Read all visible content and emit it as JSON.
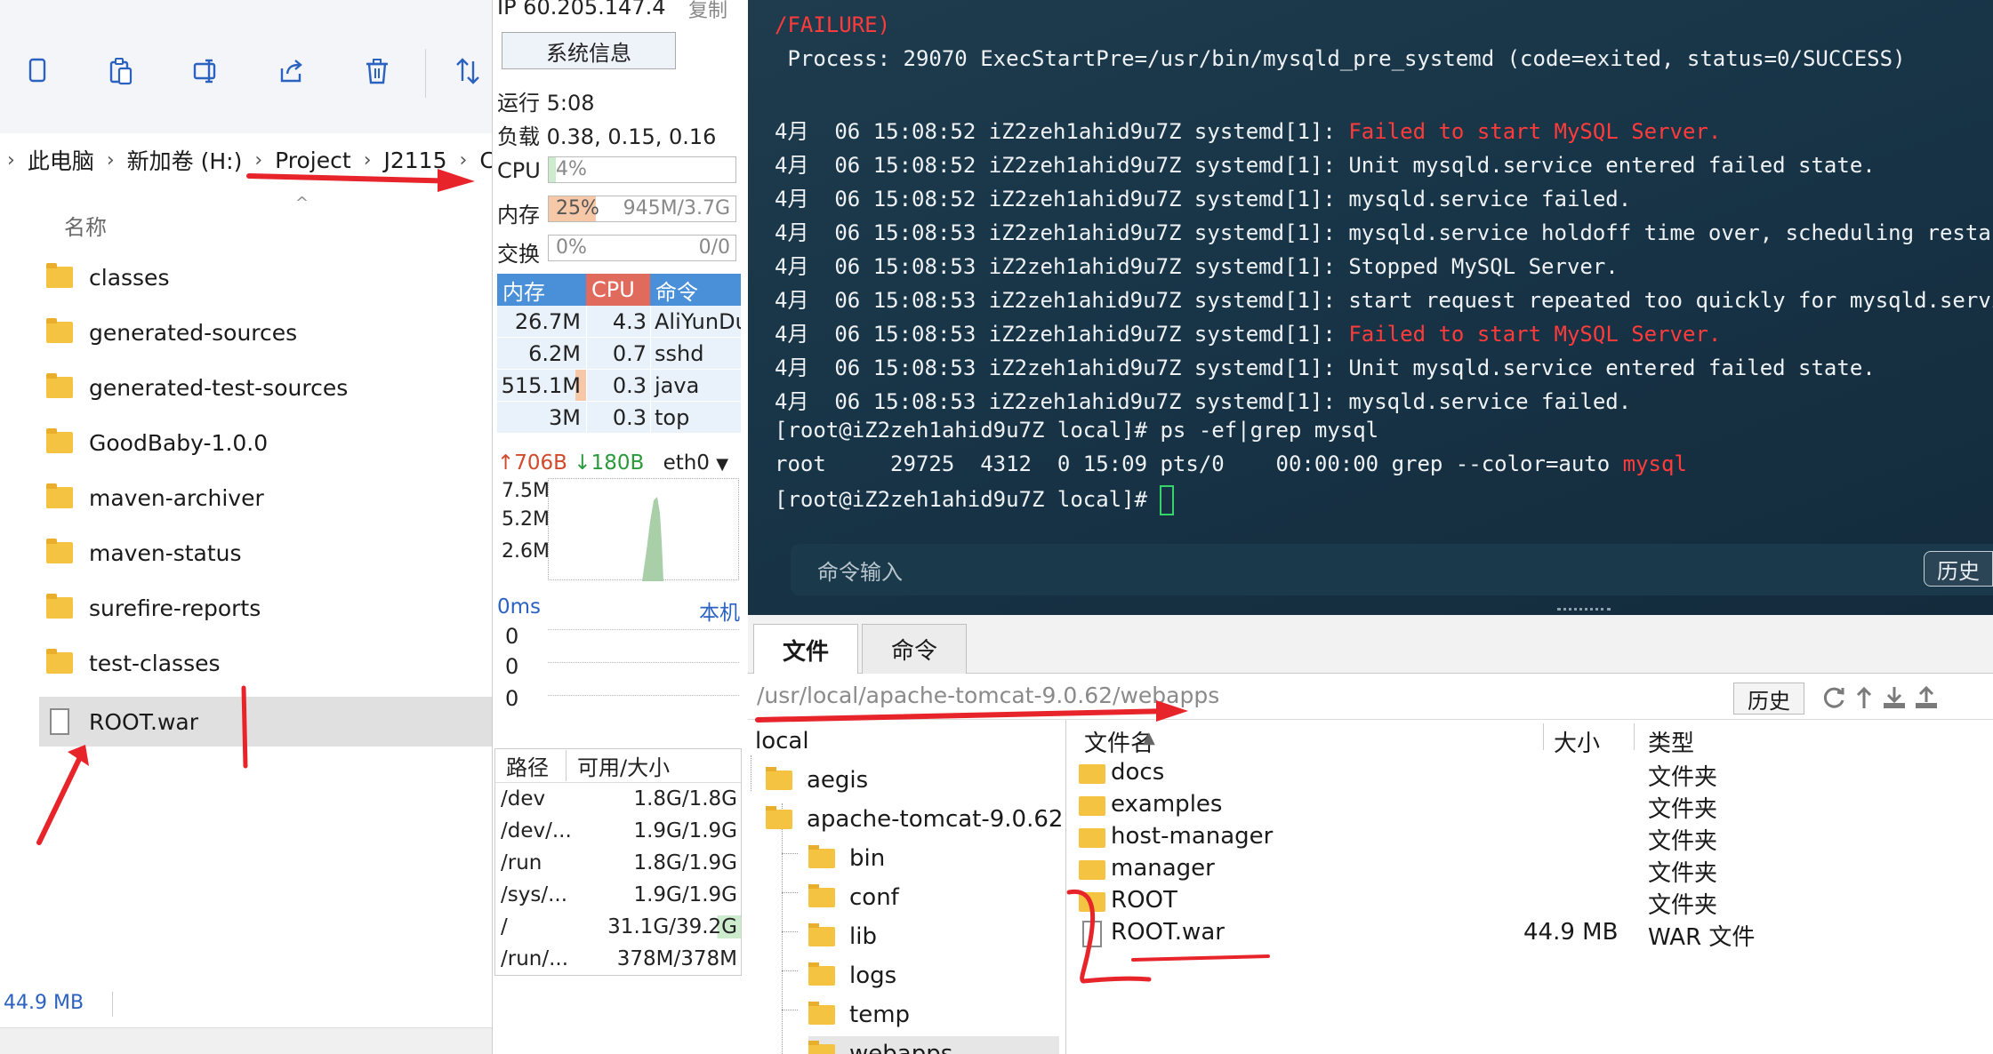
{
  "explorer": {
    "breadcrumb": [
      "此电脑",
      "新加卷 (H:)",
      "Project",
      "J2115"
    ],
    "breadcrumb_trail": "C",
    "column_name": "名称",
    "items": [
      {
        "name": "classes",
        "type": "folder"
      },
      {
        "name": "generated-sources",
        "type": "folder"
      },
      {
        "name": "generated-test-sources",
        "type": "folder"
      },
      {
        "name": "GoodBaby-1.0.0",
        "type": "folder"
      },
      {
        "name": "maven-archiver",
        "type": "folder"
      },
      {
        "name": "maven-status",
        "type": "folder"
      },
      {
        "name": "surefire-reports",
        "type": "folder"
      },
      {
        "name": "test-classes",
        "type": "folder"
      },
      {
        "name": "ROOT.war",
        "type": "file"
      }
    ],
    "status_size": "44.9 MB",
    "toolbar_icons": [
      "copy-icon",
      "paste-icon",
      "rename-icon",
      "share-icon",
      "delete-icon",
      "sort-icon"
    ]
  },
  "monitor": {
    "ip": "IP 60.205.147.4",
    "copy": "复制",
    "sysinfo": "系统信息",
    "uptime": "运行 5:08",
    "load": "负载 0.38, 0.15, 0.16",
    "cpu_label": "CPU",
    "cpu_value": "4%",
    "cpu_pct": 4,
    "mem_label": "内存",
    "mem_value": "25%",
    "mem_pct": 25,
    "mem_detail": "945M/3.7G",
    "swap_label": "交换",
    "swap_value": "0%",
    "swap_detail": "0/0",
    "proc_head": [
      "内存",
      "CPU",
      "命令"
    ],
    "procs": [
      {
        "mem": "26.7M",
        "cpu": "4.3",
        "cmd": "AliYunDun"
      },
      {
        "mem": "6.2M",
        "cpu": "0.7",
        "cmd": "sshd"
      },
      {
        "mem": "515.1M",
        "cpu": "0.3",
        "cmd": "java"
      },
      {
        "mem": "3M",
        "cpu": "0.3",
        "cmd": "top"
      }
    ],
    "net_up": "706B",
    "net_down": "180B",
    "net_iface": "eth0",
    "net_scale": [
      "7.5M",
      "5.2M",
      "2.6M"
    ],
    "latency": "0ms",
    "latency_target": "本机",
    "latency_values": [
      "0",
      "0",
      "0"
    ],
    "disk_head": [
      "路径",
      "可用/大小"
    ],
    "disks": [
      {
        "path": "/dev",
        "size": "1.8G/1.8G"
      },
      {
        "path": "/dev/...",
        "size": "1.9G/1.9G"
      },
      {
        "path": "/run",
        "size": "1.8G/1.9G"
      },
      {
        "path": "/sys/...",
        "size": "1.9G/1.9G"
      },
      {
        "path": "/",
        "size": "31.1G/39.2G"
      },
      {
        "path": "/run/...",
        "size": "378M/378M"
      }
    ],
    "colors": {
      "cpu_head": "#e06a5c",
      "mem_head": "#4a90d9",
      "mem_fill": "#f7c8a8",
      "cpu_fill": "#cdeccd"
    }
  },
  "terminal": {
    "lines": [
      {
        "segments": [
          {
            "t": "/FAILURE)",
            "c": "red"
          }
        ]
      },
      {
        "segments": [
          {
            "t": " Process: 29070 ExecStartPre=/usr/bin/mysqld_pre_systemd (code=exited, status=0/SUCCESS)",
            "c": ""
          }
        ]
      },
      {
        "segments": [
          {
            "t": "",
            "c": ""
          }
        ]
      },
      {
        "segments": [
          {
            "t": "4月  06 15:08:52 iZ2zeh1ahid9u7Z systemd[1]: ",
            "c": ""
          },
          {
            "t": "Failed to start MySQL Server.",
            "c": "red"
          }
        ]
      },
      {
        "segments": [
          {
            "t": "4月  06 15:08:52 iZ2zeh1ahid9u7Z systemd[1]: Unit mysqld.service entered failed state.",
            "c": ""
          }
        ]
      },
      {
        "segments": [
          {
            "t": "4月  06 15:08:52 iZ2zeh1ahid9u7Z systemd[1]: mysqld.service failed.",
            "c": ""
          }
        ]
      },
      {
        "segments": [
          {
            "t": "4月  06 15:08:53 iZ2zeh1ahid9u7Z systemd[1]: mysqld.service holdoff time over, scheduling restart.",
            "c": ""
          }
        ]
      },
      {
        "segments": [
          {
            "t": "4月  06 15:08:53 iZ2zeh1ahid9u7Z systemd[1]: Stopped MySQL Server.",
            "c": ""
          }
        ]
      },
      {
        "segments": [
          {
            "t": "4月  06 15:08:53 iZ2zeh1ahid9u7Z systemd[1]: start request repeated too quickly for mysqld.service",
            "c": ""
          }
        ]
      },
      {
        "segments": [
          {
            "t": "4月  06 15:08:53 iZ2zeh1ahid9u7Z systemd[1]: ",
            "c": ""
          },
          {
            "t": "Failed to start MySQL Server.",
            "c": "red"
          }
        ]
      },
      {
        "segments": [
          {
            "t": "4月  06 15:08:53 iZ2zeh1ahid9u7Z systemd[1]: Unit mysqld.service entered failed state.",
            "c": ""
          }
        ]
      },
      {
        "segments": [
          {
            "t": "4月  06 15:08:53 iZ2zeh1ahid9u7Z systemd[1]: mysqld.service failed.",
            "c": ""
          }
        ]
      },
      {
        "segments": [
          {
            "t": "[root@iZ2zeh1ahid9u7Z local]# ps -ef|grep mysql",
            "c": ""
          }
        ]
      },
      {
        "segments": [
          {
            "t": "root     29725  4312  0 15:09 pts/0    00:00:00 grep --color=auto ",
            "c": ""
          },
          {
            "t": "mysql",
            "c": "red"
          }
        ]
      },
      {
        "segments": [
          {
            "t": "[root@iZ2zeh1ahid9u7Z local]# ",
            "c": ""
          }
        ]
      }
    ],
    "input_placeholder": "命令输入",
    "history": "历史"
  },
  "filemgr": {
    "tabs": [
      "文件",
      "命令"
    ],
    "path": "/usr/local/apache-tomcat-9.0.62/webapps",
    "history": "历史",
    "tree": [
      {
        "name": "local",
        "level": 0,
        "icon": false
      },
      {
        "name": "aegis",
        "level": 1,
        "icon": true
      },
      {
        "name": "apache-tomcat-9.0.62",
        "level": 1,
        "icon": true
      },
      {
        "name": "bin",
        "level": 2,
        "icon": true
      },
      {
        "name": "conf",
        "level": 2,
        "icon": true
      },
      {
        "name": "lib",
        "level": 2,
        "icon": true
      },
      {
        "name": "logs",
        "level": 2,
        "icon": true
      },
      {
        "name": "temp",
        "level": 2,
        "icon": true
      },
      {
        "name": "webapps",
        "level": 2,
        "icon": true
      }
    ],
    "list_head": [
      "文件名",
      "大小",
      "类型"
    ],
    "files": [
      {
        "name": "docs",
        "size": "",
        "type": "文件夹",
        "folder": true
      },
      {
        "name": "examples",
        "size": "",
        "type": "文件夹",
        "folder": true
      },
      {
        "name": "host-manager",
        "size": "",
        "type": "文件夹",
        "folder": true
      },
      {
        "name": "manager",
        "size": "",
        "type": "文件夹",
        "folder": true
      },
      {
        "name": "ROOT",
        "size": "",
        "type": "文件夹",
        "folder": true
      },
      {
        "name": "ROOT.war",
        "size": "44.9 MB",
        "type": "WAR 文件",
        "folder": false
      }
    ],
    "action_icons": [
      "refresh-icon",
      "up-icon",
      "download-icon",
      "upload-icon"
    ]
  }
}
